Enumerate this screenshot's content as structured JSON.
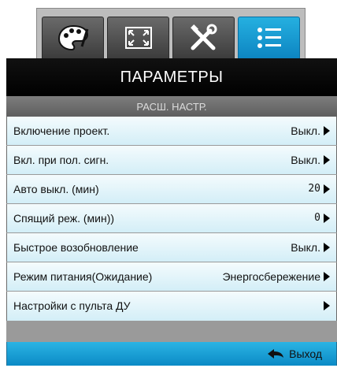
{
  "tabs": [
    {
      "icon": "palette-icon",
      "active": false
    },
    {
      "icon": "screen-resize-icon",
      "active": false
    },
    {
      "icon": "tools-icon",
      "active": false
    },
    {
      "icon": "list-settings-icon",
      "active": true
    }
  ],
  "header": {
    "title": "ПАРАМЕТРЫ",
    "subtitle": "РАСШ. НАСТР."
  },
  "rows": [
    {
      "label": "Включение проект.",
      "value": "Выкл."
    },
    {
      "label": "Вкл. при пол. сигн.",
      "value": "Выкл."
    },
    {
      "label": "Авто выкл. (мин)",
      "value": "20"
    },
    {
      "label": "Спящий реж. (мин))",
      "value": "0"
    },
    {
      "label": "Быстрое возобновление",
      "value": "Выкл."
    },
    {
      "label": "Режим питания(Ожидание)",
      "value": "Энергосбережение"
    },
    {
      "label": "Настройки с пульта ДУ",
      "value": ""
    }
  ],
  "footer": {
    "exit_label": "Выход"
  },
  "colors": {
    "accent": "#0d85c2",
    "row_bg": "#d3eef7",
    "title_bg": "#000000"
  }
}
